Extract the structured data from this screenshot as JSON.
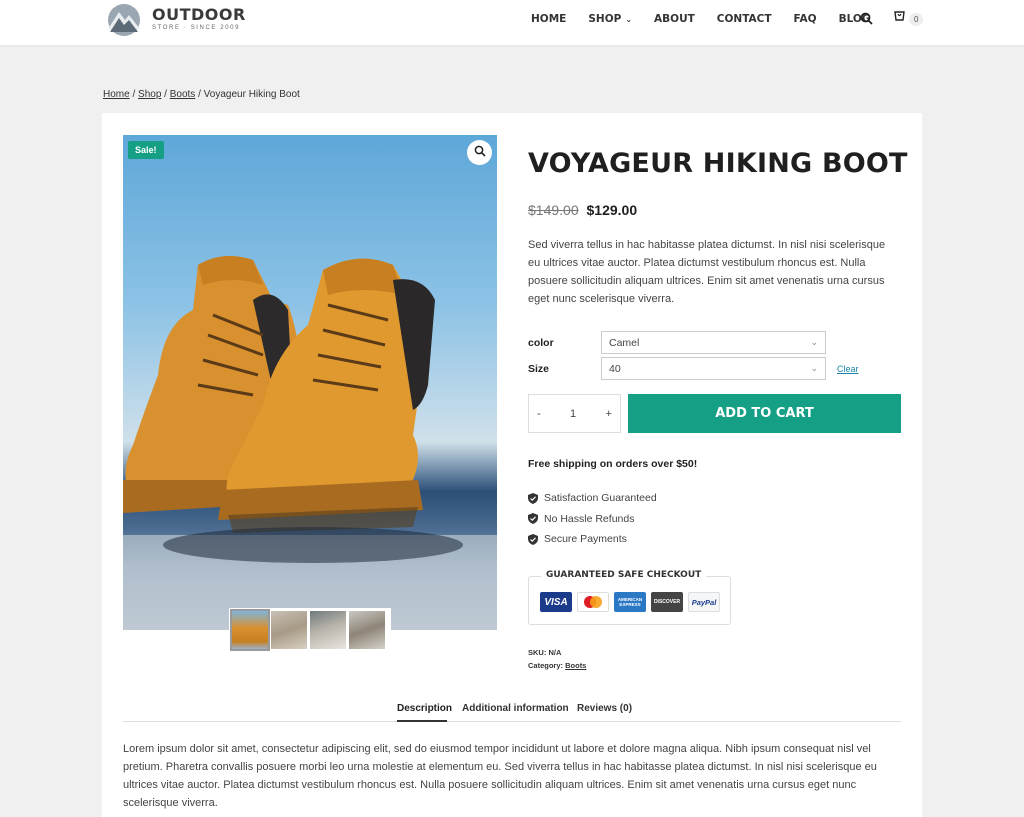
{
  "header": {
    "logo_title": "OUTDOOR",
    "logo_tagline": "STORE · SINCE 2009",
    "nav": [
      "HOME",
      "SHOP",
      "ABOUT",
      "CONTACT",
      "FAQ",
      "BLOG"
    ],
    "cart_count": "0"
  },
  "breadcrumb": {
    "home": "Home",
    "shop": "Shop",
    "boots": "Boots",
    "current": "Voyageur Hiking Boot",
    "sep": "/"
  },
  "gallery": {
    "sale_badge": "Sale!"
  },
  "product": {
    "title": "VOYAGEUR HIKING BOOT",
    "price_old": "$149.00",
    "price_new": "$129.00",
    "description": "Sed viverra tellus in hac habitasse platea dictumst. In nisl nisi scelerisque eu ultrices vitae auctor. Platea dictumst vestibulum rhoncus est. Nulla posuere sollicitudin aliquam ultrices. Enim sit amet venenatis urna cursus eget nunc scelerisque viverra.",
    "color_label": "color",
    "color_value": "Camel",
    "size_label": "Size",
    "size_value": "40",
    "clear_label": "Clear",
    "qty_minus": "-",
    "qty_value": "1",
    "qty_plus": "+",
    "add_to_cart": "ADD TO CART",
    "shipping": "Free shipping on orders over $50!",
    "features": [
      "Satisfaction Guaranteed",
      "No Hassle Refunds",
      "Secure Payments"
    ],
    "checkout_title": "GUARANTEED SAFE CHECKOUT",
    "payment_methods": [
      "VISA",
      "Mastercard",
      "AMERICAN EXPRESS",
      "DISCOVER",
      "PayPal"
    ],
    "sku_label": "SKU:",
    "sku_value": "N/A",
    "category_label": "Category:",
    "category_value": "Boots"
  },
  "tabs": {
    "description": "Description",
    "additional": "Additional information",
    "reviews": "Reviews (0)"
  },
  "long_description": "Lorem ipsum dolor sit amet, consectetur adipiscing elit, sed do eiusmod tempor incididunt ut labore et dolore magna aliqua. Nibh ipsum consequat nisl vel pretium. Pharetra convallis posuere morbi leo urna molestie at elementum eu. Sed viverra tellus in hac habitasse platea dictumst. In nisl nisi scelerisque eu ultrices vitae auctor. Platea dictumst vestibulum rhoncus est. Nulla posuere sollicitudin aliquam ultrices. Enim sit amet venenatis urna cursus eget nunc scelerisque viverra.",
  "colors": {
    "accent": "#15a085",
    "link": "#1a82a8"
  }
}
